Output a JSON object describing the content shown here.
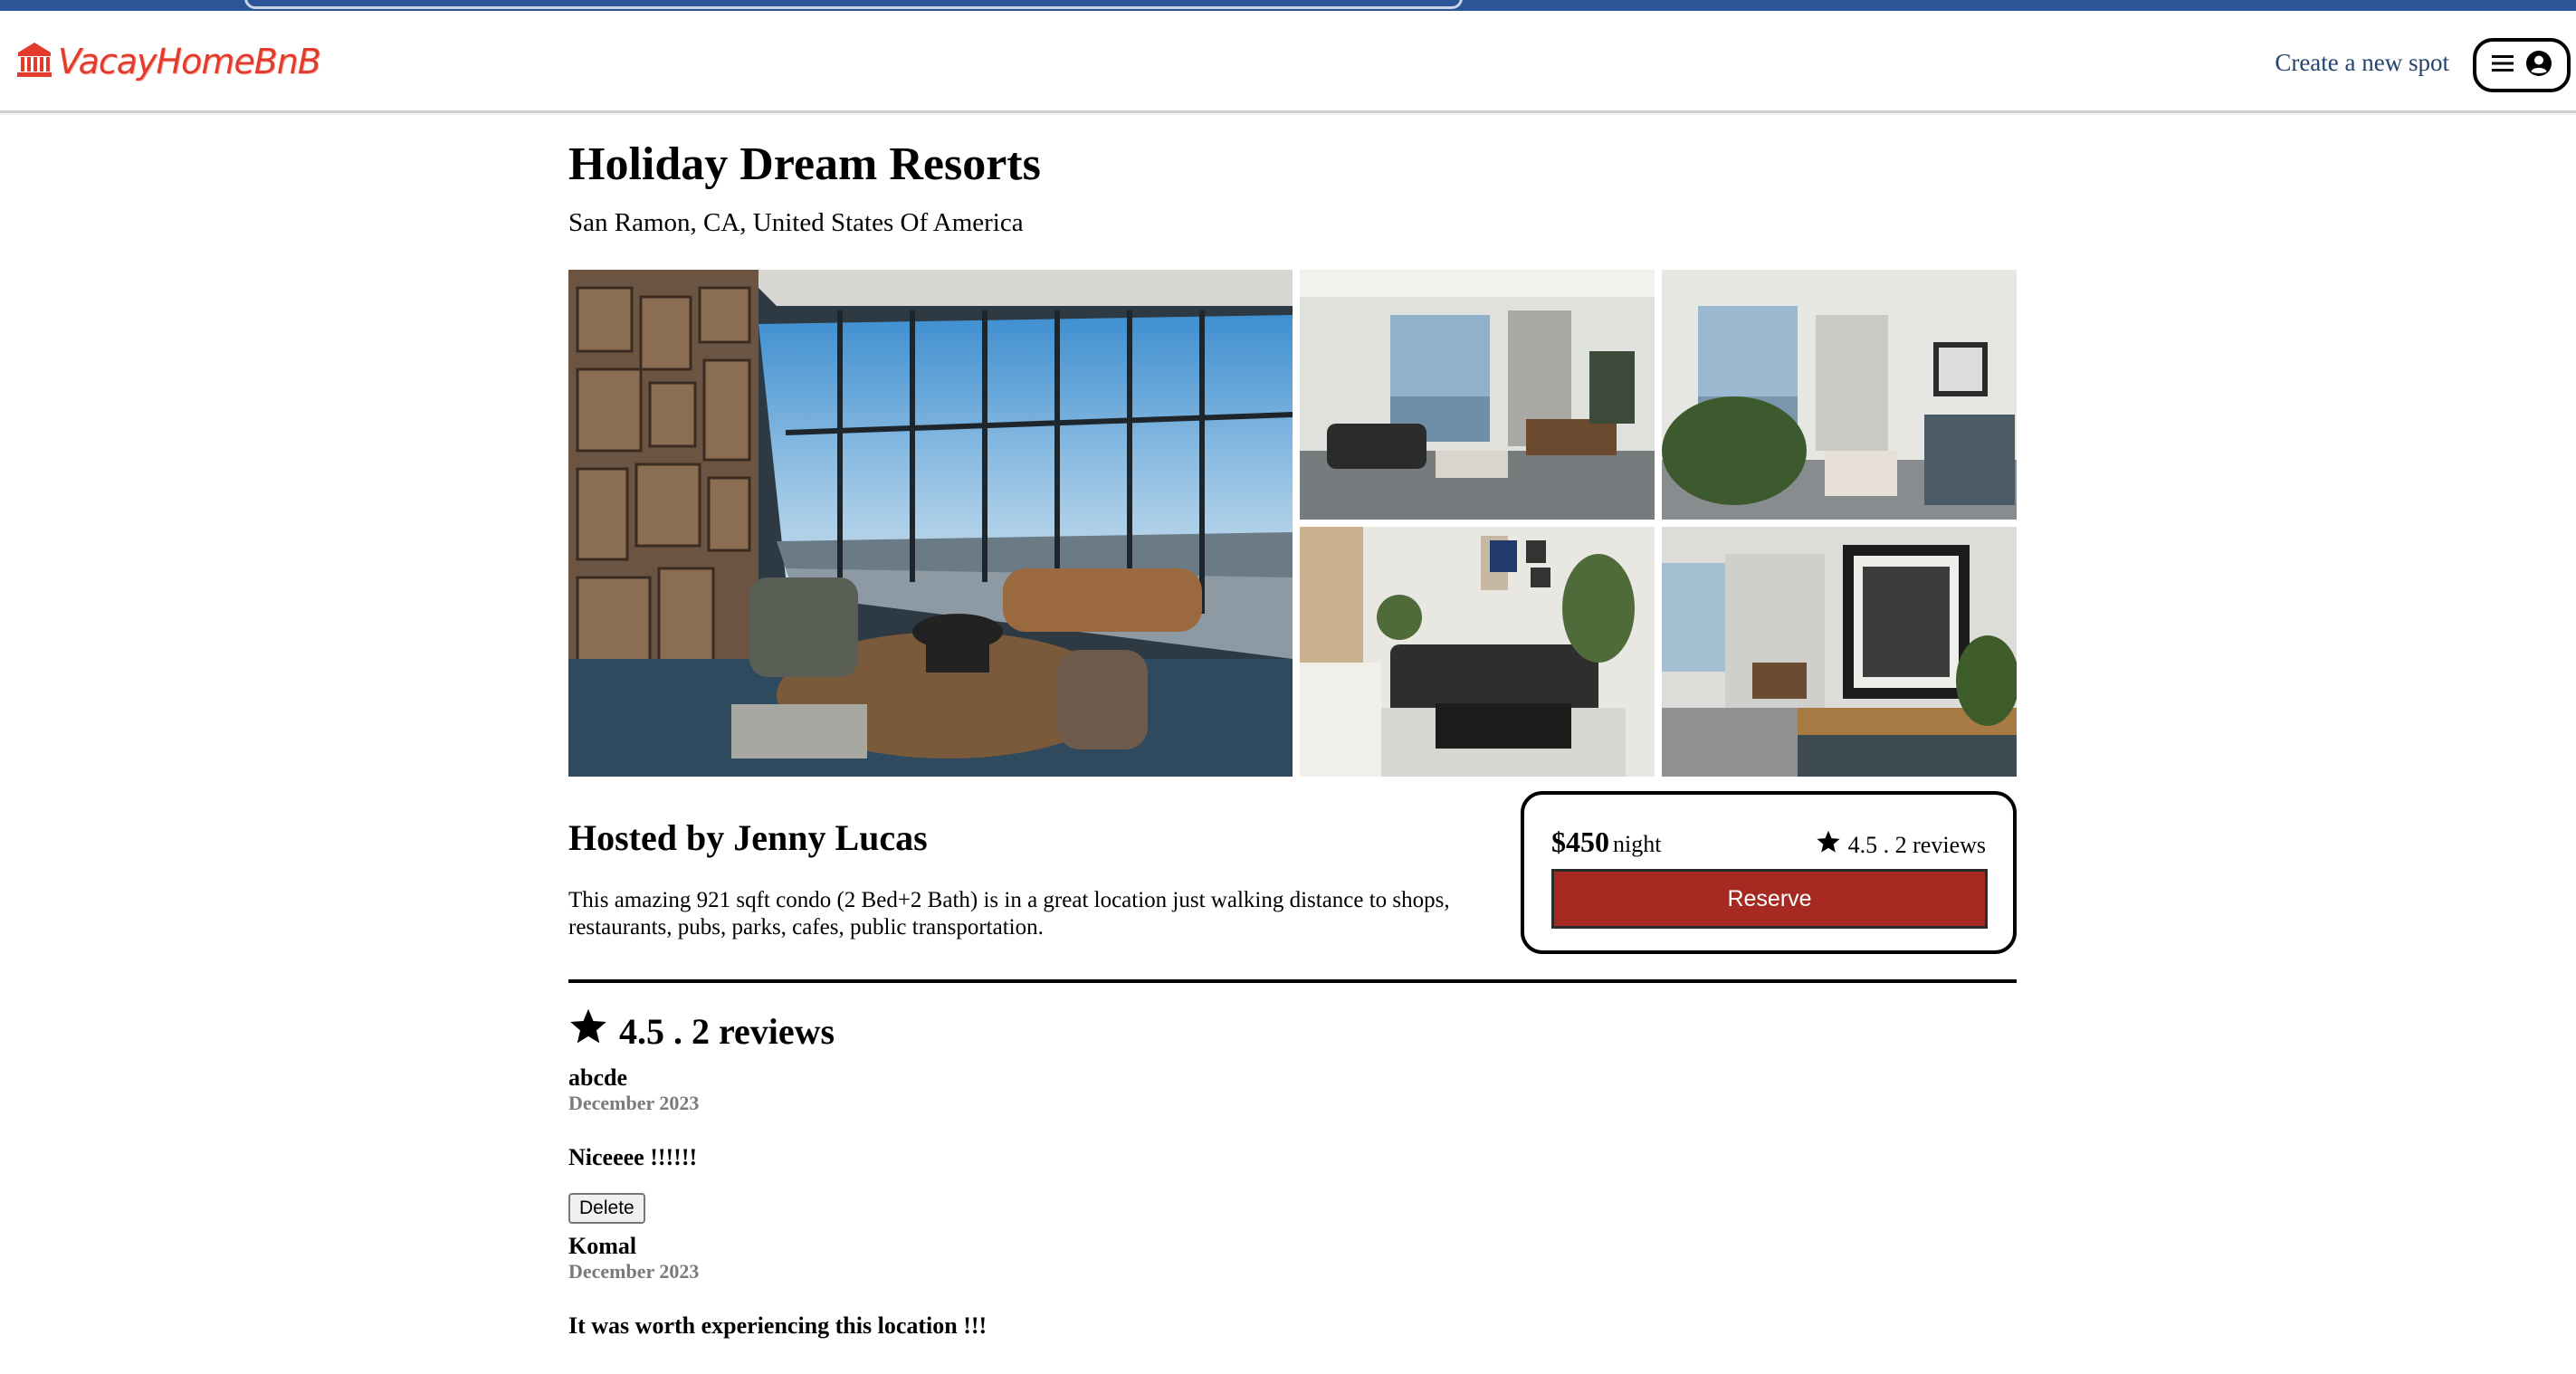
{
  "header": {
    "logo_text": "VacayHomeBnB",
    "create_link": "Create a new spot",
    "brand_color": "#e23b2c"
  },
  "spot": {
    "name": "Holiday Dream Resorts",
    "location": "San Ramon, CA, United States Of America",
    "host_heading": "Hosted by Jenny Lucas",
    "description": "This amazing 921 sqft condo (2 Bed+2 Bath) is in a great location just walking distance to shops, restaurants, pubs, parks, cafes, public transportation."
  },
  "booking": {
    "price": "$450",
    "unit": "night",
    "rating_summary": "4.5 . 2 reviews",
    "reserve_label": "Reserve",
    "reserve_color": "#a62a22"
  },
  "reviews": {
    "summary": "4.5 . 2 reviews",
    "items": [
      {
        "author": "abcde",
        "date": "December 2023",
        "text": "Niceeee !!!!!!",
        "delete_label": "Delete"
      },
      {
        "author": "Komal",
        "date": "December 2023",
        "text": "It was worth experiencing this location !!!"
      }
    ]
  },
  "icons": [
    "logo-building-icon",
    "menu-icon",
    "user-circle-icon",
    "star-icon"
  ]
}
